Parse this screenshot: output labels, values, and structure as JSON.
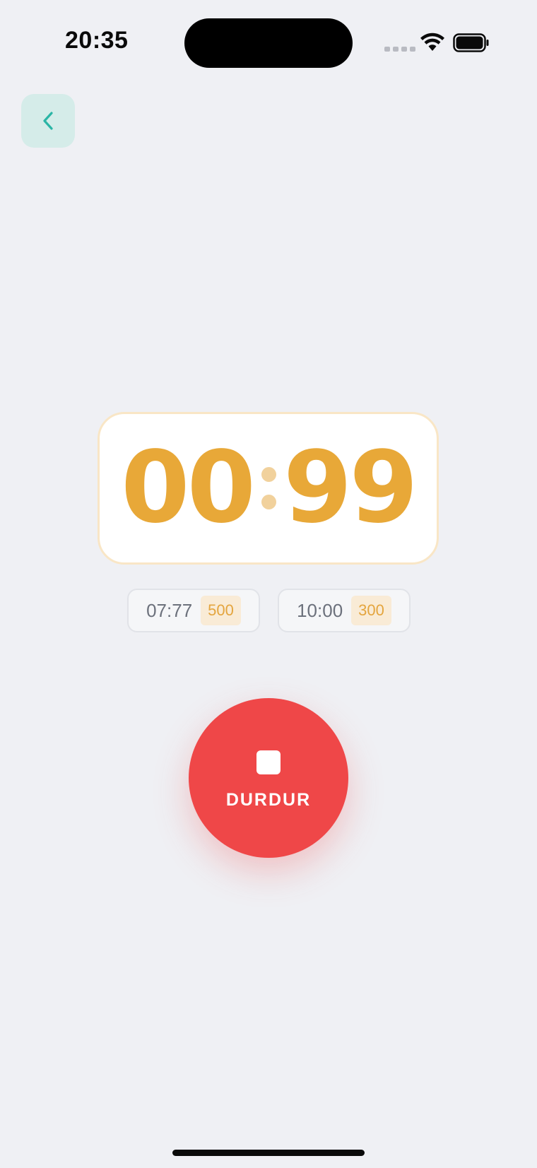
{
  "status_bar": {
    "time": "20:35",
    "wifi_icon": "wifi-icon",
    "battery_icon": "battery-icon"
  },
  "nav": {
    "back_icon": "chevron-left-icon",
    "accent_color": "#2bb5a6"
  },
  "timer": {
    "minutes": "00",
    "seconds": "99",
    "color": "#e8a838"
  },
  "laps": [
    {
      "time": "07:77",
      "points": "500"
    },
    {
      "time": "10:00",
      "points": "300"
    }
  ],
  "stop_button": {
    "label": "DURDUR",
    "icon": "stop-icon",
    "color": "#ef4748"
  }
}
